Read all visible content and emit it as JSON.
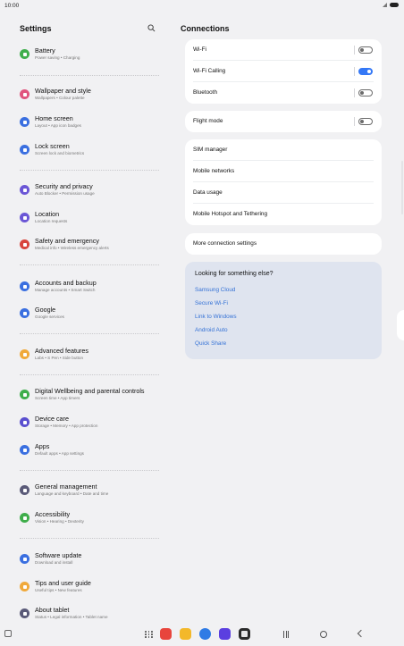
{
  "status": {
    "time": "10:00"
  },
  "left": {
    "title": "Settings",
    "items": [
      {
        "title": "Battery",
        "sub": "Power saving  •  Charging",
        "color": "#3fae4b",
        "icon": "battery-icon"
      },
      {
        "title": "Wallpaper and style",
        "sub": "Wallpapers  •  Colour palette",
        "color": "#e0557d",
        "icon": "wallpaper-icon"
      },
      {
        "title": "Home screen",
        "sub": "Layout  •  App icon badges",
        "color": "#3a6fe0",
        "icon": "home-icon"
      },
      {
        "title": "Lock screen",
        "sub": "Screen lock and biometrics",
        "color": "#3a6fe0",
        "icon": "lock-icon"
      },
      {
        "title": "Security and privacy",
        "sub": "Auto Blocker  •  Permission usage",
        "color": "#6b56d6",
        "icon": "shield-icon"
      },
      {
        "title": "Location",
        "sub": "Location requests",
        "color": "#6b56d6",
        "icon": "location-icon"
      },
      {
        "title": "Safety and emergency",
        "sub": "Medical info  •  Wireless emergency alerts",
        "color": "#d8453c",
        "icon": "emergency-icon"
      },
      {
        "title": "Accounts and backup",
        "sub": "Manage accounts  •  Smart Switch",
        "color": "#3a6fe0",
        "icon": "accounts-icon"
      },
      {
        "title": "Google",
        "sub": "Google services",
        "color": "#3a6fe0",
        "icon": "google-icon"
      },
      {
        "title": "Advanced features",
        "sub": "Labs  •  S Pen  •  Side button",
        "color": "#f0a93a",
        "icon": "advanced-features-icon"
      },
      {
        "title": "Digital Wellbeing and parental controls",
        "sub": "Screen time  •  App timers",
        "color": "#3fae4b",
        "icon": "wellbeing-icon"
      },
      {
        "title": "Device care",
        "sub": "Storage  •  Memory  •  App protection",
        "color": "#5a4fcf",
        "icon": "device-care-icon"
      },
      {
        "title": "Apps",
        "sub": "Default apps  •  App settings",
        "color": "#3a6fe0",
        "icon": "apps-icon"
      },
      {
        "title": "General management",
        "sub": "Language and keyboard  •  Date and time",
        "color": "#5a5a78",
        "icon": "general-management-icon"
      },
      {
        "title": "Accessibility",
        "sub": "Vision  •  Hearing  •  Dexterity",
        "color": "#3fae4b",
        "icon": "accessibility-icon"
      },
      {
        "title": "Software update",
        "sub": "Download and install",
        "color": "#3a6fe0",
        "icon": "software-update-icon"
      },
      {
        "title": "Tips and user guide",
        "sub": "Useful tips  •  New features",
        "color": "#f0a93a",
        "icon": "tips-icon"
      },
      {
        "title": "About tablet",
        "sub": "Status  •  Legal information  •  Tablet name",
        "color": "#5a5a78",
        "icon": "info-icon"
      }
    ]
  },
  "right": {
    "title": "Connections",
    "rows": {
      "wifi": {
        "label": "Wi-Fi",
        "on": false
      },
      "wifi_calling": {
        "label": "Wi-Fi Calling",
        "on": true
      },
      "bluetooth": {
        "label": "Bluetooth",
        "on": false
      },
      "flight": {
        "label": "Flight mode",
        "on": false
      },
      "sim": {
        "label": "SIM manager"
      },
      "mobile_networks": {
        "label": "Mobile networks"
      },
      "data_usage": {
        "label": "Data usage"
      },
      "hotspot": {
        "label": "Mobile Hotspot and Tethering"
      },
      "more": {
        "label": "More connection settings"
      }
    },
    "suggest": {
      "heading": "Looking for something else?",
      "links": [
        "Samsung Cloud",
        "Secure Wi-Fi",
        "Link to Windows",
        "Android Auto",
        "Quick Share"
      ]
    }
  },
  "dock": {
    "apps": [
      {
        "icon": "red-app-icon",
        "color": "#e8453c"
      },
      {
        "icon": "folder-app-icon",
        "color": "#f3b82a"
      },
      {
        "icon": "messages-app-icon",
        "color": "#2f7be5"
      },
      {
        "icon": "pen-app-icon",
        "color": "#5b3fe0"
      },
      {
        "icon": "camera-app-icon",
        "color": "#2a2a2a"
      }
    ]
  }
}
